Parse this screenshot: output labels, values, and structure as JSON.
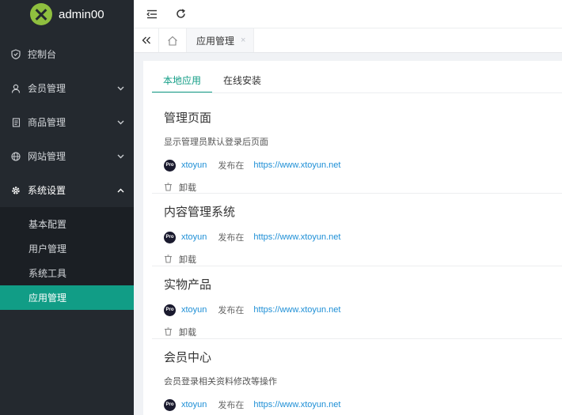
{
  "app": {
    "name": "admin00"
  },
  "sidebar": {
    "items": [
      {
        "label": "控制台",
        "icon": "shield-icon"
      },
      {
        "label": "会员管理",
        "icon": "user-icon"
      },
      {
        "label": "商品管理",
        "icon": "document-icon"
      },
      {
        "label": "网站管理",
        "icon": "globe-icon"
      },
      {
        "label": "系统设置",
        "icon": "gear-icon"
      }
    ],
    "submenu": [
      {
        "label": "基本配置"
      },
      {
        "label": "用户管理"
      },
      {
        "label": "系统工具"
      },
      {
        "label": "应用管理"
      }
    ]
  },
  "tabs": {
    "open": [
      {
        "label": "应用管理",
        "close": "×"
      }
    ]
  },
  "content": {
    "subtabs": [
      {
        "label": "本地应用"
      },
      {
        "label": "在线安装"
      }
    ],
    "apps": [
      {
        "title": "管理页面",
        "desc": "显示管理员默认登录后页面",
        "badge": "Pro",
        "author": "xtoyun",
        "published_label": "发布在",
        "url": "https://www.xtoyun.net",
        "action": "卸载"
      },
      {
        "title": "内容管理系统",
        "badge": "Pro",
        "author": "xtoyun",
        "published_label": "发布在",
        "url": "https://www.xtoyun.net",
        "action": "卸载"
      },
      {
        "title": "实物产品",
        "badge": "Pro",
        "author": "xtoyun",
        "published_label": "发布在",
        "url": "https://www.xtoyun.net",
        "action": "卸载"
      },
      {
        "title": "会员中心",
        "desc": "会员登录相关资料修改等操作",
        "badge": "Pro",
        "author": "xtoyun",
        "published_label": "发布在",
        "url": "https://www.xtoyun.net"
      }
    ]
  },
  "colors": {
    "sidebar_bg": "#24292f",
    "accent": "#119d86",
    "link": "#1e8fd6"
  }
}
